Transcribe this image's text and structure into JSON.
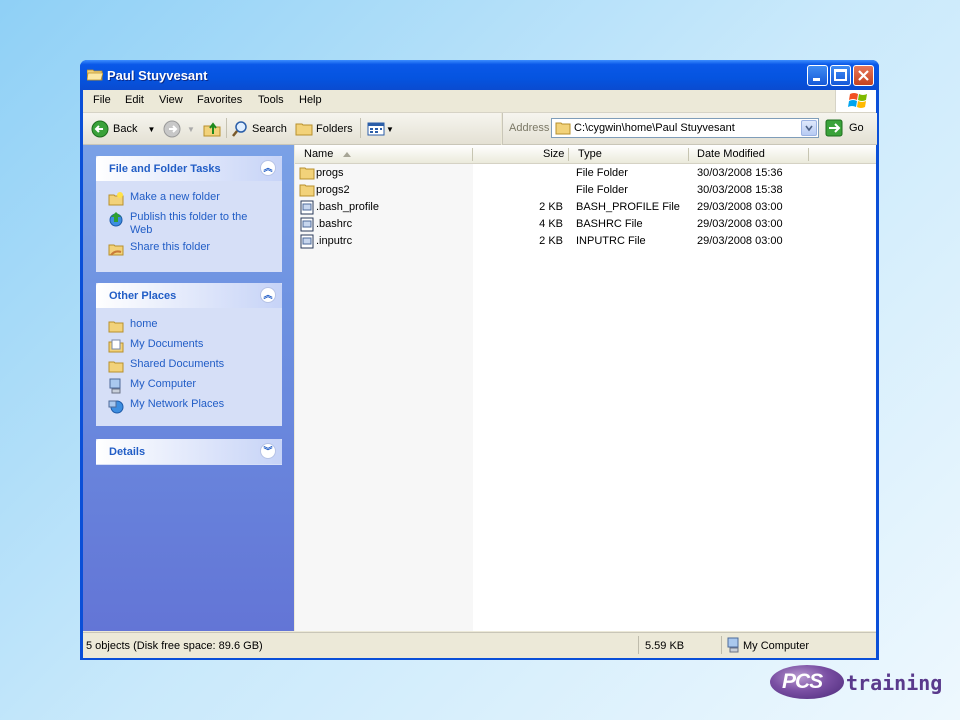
{
  "window": {
    "title": "Paul Stuyvesant"
  },
  "menu": [
    "File",
    "Edit",
    "View",
    "Favorites",
    "Tools",
    "Help"
  ],
  "toolbar": {
    "back_label": "Back",
    "search_label": "Search",
    "folders_label": "Folders"
  },
  "address": {
    "label": "Address",
    "value": "C:\\cygwin\\home\\Paul Stuyvesant",
    "go_label": "Go"
  },
  "tasks_panel": {
    "title": "File and Folder Tasks",
    "items": [
      {
        "label": "Make a new folder",
        "icon": "new-folder-icon"
      },
      {
        "label": "Publish this folder to the Web",
        "icon": "publish-web-icon"
      },
      {
        "label": "Share this folder",
        "icon": "share-folder-icon"
      }
    ]
  },
  "places_panel": {
    "title": "Other Places",
    "items": [
      {
        "label": "home",
        "icon": "folder-icon"
      },
      {
        "label": "My Documents",
        "icon": "my-documents-icon"
      },
      {
        "label": "Shared Documents",
        "icon": "folder-icon"
      },
      {
        "label": "My Computer",
        "icon": "my-computer-icon"
      },
      {
        "label": "My Network Places",
        "icon": "network-places-icon"
      }
    ]
  },
  "details_panel": {
    "title": "Details"
  },
  "columns": {
    "name": "Name",
    "size": "Size",
    "type": "Type",
    "modified": "Date Modified"
  },
  "files": [
    {
      "name": "progs",
      "size": "",
      "type": "File Folder",
      "modified": "30/03/2008 15:36",
      "icon": "folder-icon"
    },
    {
      "name": "progs2",
      "size": "",
      "type": "File Folder",
      "modified": "30/03/2008 15:38",
      "icon": "folder-icon"
    },
    {
      "name": ".bash_profile",
      "size": "2 KB",
      "type": "BASH_PROFILE File",
      "modified": "29/03/2008 03:00",
      "icon": "file-icon"
    },
    {
      "name": ".bashrc",
      "size": "4 KB",
      "type": "BASHRC File",
      "modified": "29/03/2008 03:00",
      "icon": "file-icon"
    },
    {
      "name": ".inputrc",
      "size": "2 KB",
      "type": "INPUTRC File",
      "modified": "29/03/2008 03:00",
      "icon": "file-icon"
    }
  ],
  "status": {
    "objects": "5 objects (Disk free space: 89.6 GB)",
    "size": "5.59 KB",
    "location": "My Computer"
  },
  "logo": {
    "brand": "PCS",
    "suffix": "training"
  }
}
